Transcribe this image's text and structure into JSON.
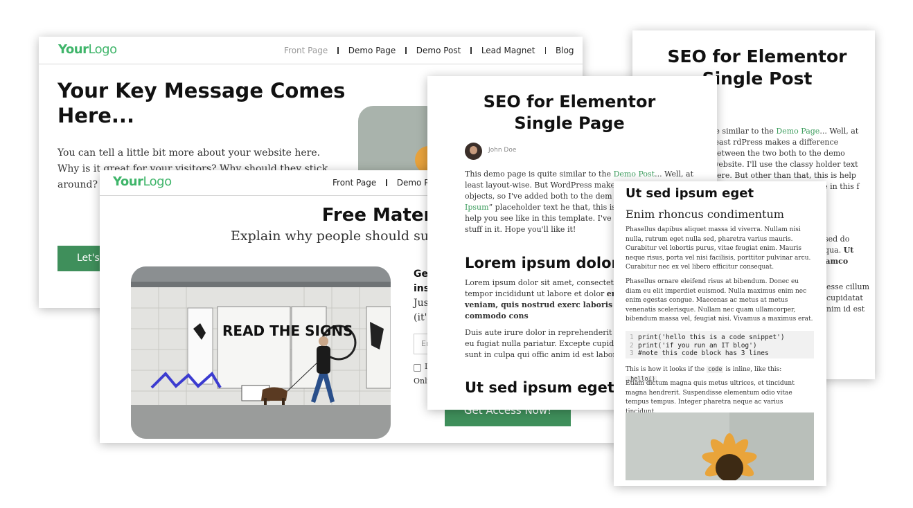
{
  "front_page": {
    "logo": {
      "part1": "Your",
      "part2": "Logo"
    },
    "nav": [
      "Front Page",
      "Demo Page",
      "Demo Post",
      "Lead Magnet",
      "Blog"
    ],
    "hero_title": "Your Key Message Comes Here...",
    "hero_text": "You can tell a little bit more about your website here. Why is it great for your visitors? Why should they stick around? Then you (Probably I'll use th",
    "cta_label": "Let's"
  },
  "lead_magnet": {
    "logo": {
      "part1": "Your",
      "part2": "Logo"
    },
    "nav": [
      "Front Page",
      "Demo Pag"
    ],
    "title": "Free Materials",
    "subtitle": "Explain why people should su",
    "photo_sign": "READ THE SIGNS",
    "side_lines": [
      "Get",
      "ins",
      "Jus",
      "(it's"
    ],
    "email_placeholder": "Er",
    "checkbox_label": "I",
    "only_text": "Only",
    "access_button": "Get Access Now!"
  },
  "seo_post": {
    "title": "SEO for Elementor Single Post",
    "meta": "2",
    "intro_pre": "te similar to the ",
    "intro_link": "Demo Page",
    "intro_post": "... Well, at least rdPress makes a difference between the two both to the demo website. I'll use the classy holder text here. But other than that, this is help you see what a post looks like in this f in it. Hope",
    "heading_fragment": "net",
    "para_fragment_a": ", sed do",
    "para_fragment_b": "liqua.",
    "para_fragment_b_bold": "Ut",
    "para_fragment_c": "llamco",
    "para_fragment_d": "esse cillum cupidatat nim id est"
  },
  "seo_page": {
    "title": "SEO for Elementor Single Page",
    "author": "John Doe",
    "intro_1": "This demo page is quite similar to the ",
    "intro_link_1": "Demo Post",
    "intro_2": "... Well, at least layout-wise. But WordPress makes a diff the two objects, so I've added both to the dem the classy “",
    "intro_link_2": "Lorem Ipsum",
    "intro_3": "” placeholder text he that, this is just a demo that will help you see like in this template. I've tried to add all the r stuff in it. Hope you'll like it!",
    "heading_1": "Lorem ipsum dolor s",
    "lorem_1": "Lorem ipsum dolor sit amet, consectetur adip eiusmod tempor incididunt ut labore et dolor",
    "lorem_1_bold": "enim ad minim veniam, quis nostrud exerc laboris nisi ut aliquip ex ea commodo cons",
    "lorem_2": "Duis aute irure dolor in reprehenderit in volu cillum dolore eu fugiat nulla pariatur. Excepte cupidatat non proident, sunt in culpa qui offic anim id est laborum.",
    "heading_2": "Ut sed ipsum eget"
  },
  "ut_sed": {
    "heading_1": "Ut sed ipsum eget",
    "heading_2": "Enim rhoncus condimentum",
    "para_1": "Phasellus dapibus aliquet massa id viverra. Nullam nisi nulla, rutrum eget nulla sed, pharetra varius mauris. Curabitur vel lobortis purus, vitae feugiat enim. Mauris neque risus, porta vel nisi facilisis, porttitor pulvinar arcu. Curabitur nec ex vel libero efficitur consequat.",
    "para_2": "Phasellus ornare eleifend risus at bibendum. Donec eu diam eu elit imperdiet euismod. Nulla maximus enim nec enim egestas congue. Maecenas ac metus at metus venenatis scelerisque. Nullam nec quam ullamcorper, bibendum massa vel, feugiat nisi. Vivamus a maximus erat.",
    "code_lines": [
      "print('hello this is a code snippet')",
      "print('if you run an IT blog')",
      "#note this code block has 3 lines"
    ],
    "code_numbers": [
      "1",
      "2",
      "3"
    ],
    "inline_pre": "This is how it looks if the ",
    "inline_code_1": "code",
    "inline_mid": " is inline, like this: ",
    "inline_code_2": ".hello()",
    "para_3": "Etiam dictum magna quis metus ultrices, et tincidunt magna hendrerit. Suspendisse elementum odio vitae tempus tempus. Integer pharetra neque ac varius tincidunt."
  }
}
